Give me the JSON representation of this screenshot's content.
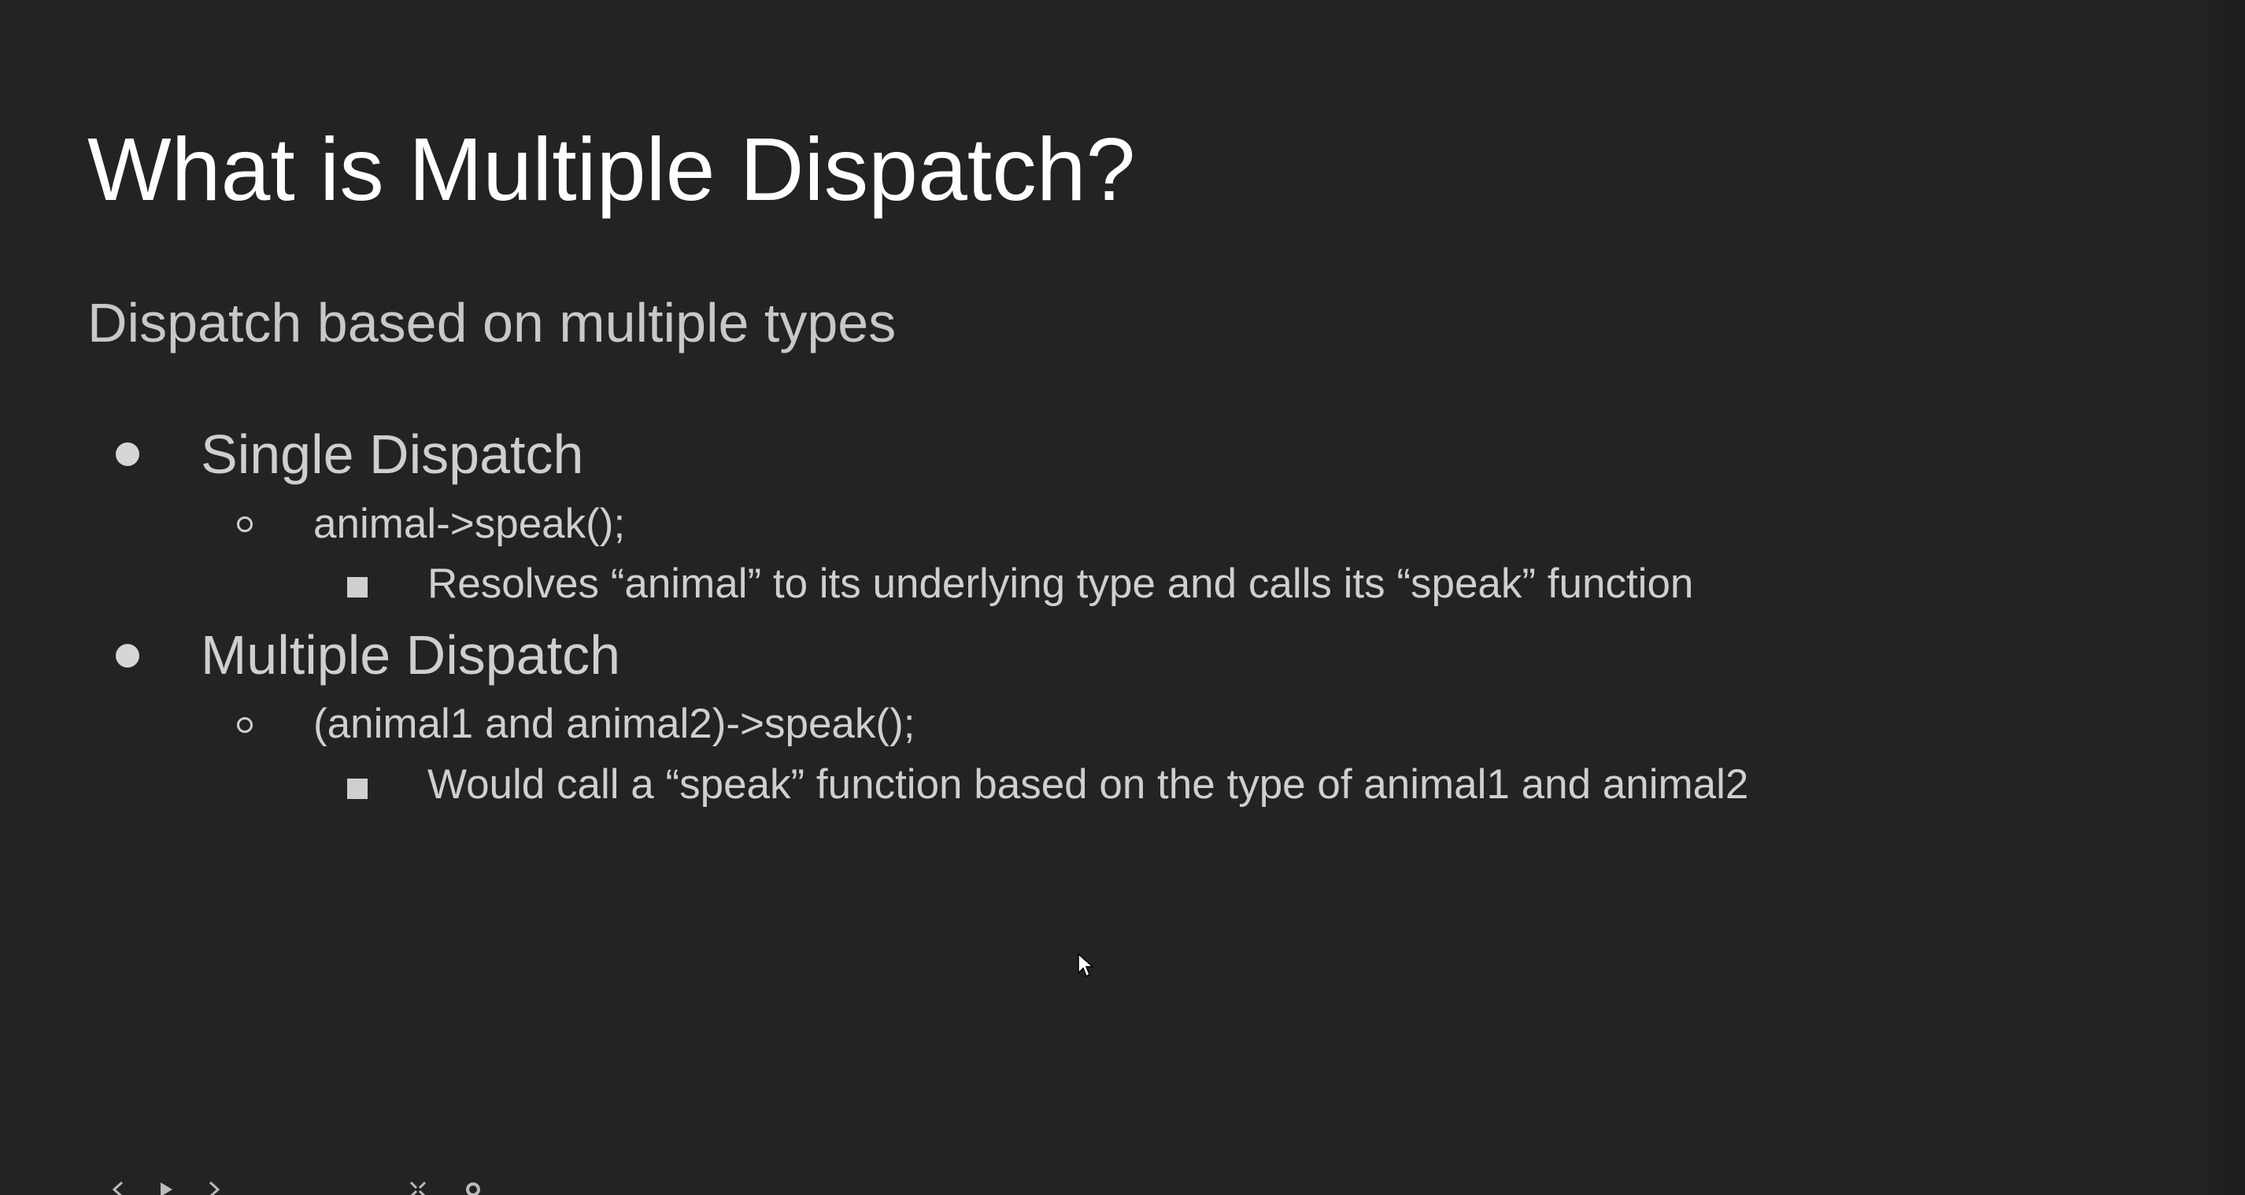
{
  "slide": {
    "title": "What is Multiple Dispatch?",
    "subtitle": "Dispatch based on multiple types",
    "bullets": [
      {
        "text": "Single Dispatch",
        "children": [
          {
            "text": "animal->speak();",
            "children": [
              {
                "text": "Resolves “animal” to its underlying type and calls its “speak” function"
              }
            ]
          }
        ]
      },
      {
        "text": "Multiple Dispatch",
        "children": [
          {
            "text": "(animal1 and animal2)->speak();",
            "children": [
              {
                "text": "Would call a “speak” function based on the type of animal1 and animal2"
              }
            ]
          }
        ]
      }
    ]
  },
  "toolbar": {
    "icons": [
      "previous-slide-icon",
      "play-icon",
      "next-slide-icon",
      "fullscreen-exit-icon",
      "settings-gear-icon"
    ]
  },
  "colors": {
    "background": "#232323",
    "title": "#ffffff",
    "body": "#cfcfcf"
  }
}
